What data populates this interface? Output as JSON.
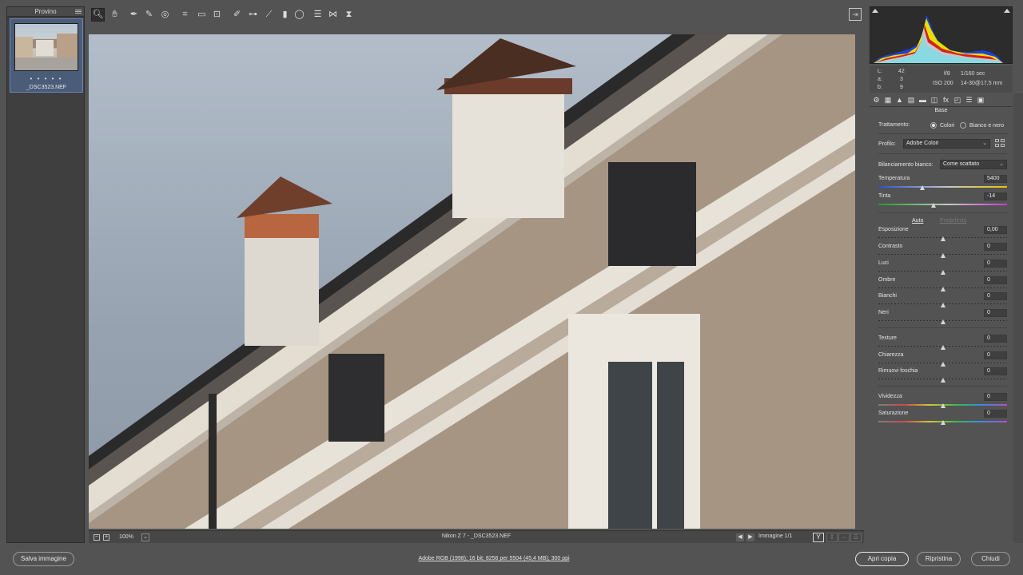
{
  "filmstrip": {
    "title": "Provino",
    "thumb": {
      "stars": "• • • • •",
      "filename": "_DSC3523.NEF"
    }
  },
  "toolbar": {
    "tools": [
      {
        "name": "zoom-tool",
        "glyph": "🔍︎",
        "active": true
      },
      {
        "name": "hand-tool",
        "glyph": "✋︎"
      },
      {
        "name": "white-balance-tool",
        "glyph": "✒"
      },
      {
        "name": "color-sampler-tool",
        "glyph": "✎"
      },
      {
        "name": "targeted-adjustment-tool",
        "glyph": "◎"
      },
      {
        "name": "crop-tool",
        "glyph": "⌗"
      },
      {
        "name": "straighten-tool",
        "glyph": "▭"
      },
      {
        "name": "transform-tool",
        "glyph": "⊡"
      },
      {
        "name": "spot-removal-tool",
        "glyph": "✐"
      },
      {
        "name": "red-eye-tool",
        "glyph": "⊶"
      },
      {
        "name": "adjustment-brush-tool",
        "glyph": "⟋"
      },
      {
        "name": "graduated-filter-tool",
        "glyph": "▮"
      },
      {
        "name": "radial-filter-tool",
        "glyph": "◯"
      },
      {
        "name": "preferences-tool",
        "glyph": "☰"
      },
      {
        "name": "rotate-left-tool",
        "glyph": "⋈"
      },
      {
        "name": "rotate-right-tool",
        "glyph": "⧗"
      }
    ],
    "export_glyph": "⇥"
  },
  "canvas_status": {
    "zoom_out": "−",
    "zoom_in": "+",
    "zoom": "100%",
    "zoom_caret": "⌄",
    "file_info": "Nikon Z 7  -  _DSC3523.NEF",
    "prev": "◀",
    "next": "▶",
    "image_count": "Immagine 1/1",
    "view_y": "Y",
    "view_compare": "⇕",
    "view_swap": "⇔",
    "view_settings": "☰"
  },
  "readout": {
    "L_label": "L:",
    "L": "42",
    "a_label": "a:",
    "a": "3",
    "b_label": "b:",
    "b": "9",
    "aperture": "f/8",
    "shutter": "1/160 sec",
    "iso": "ISO 200",
    "lens": "14-30@17,5 mm"
  },
  "panel": {
    "title": "Base",
    "tabs": [
      "⚙",
      "▦",
      "▲",
      "▤",
      "▬",
      "◫",
      "fx",
      "◰",
      "☰",
      "▣"
    ],
    "treatment_label": "Trattamento:",
    "treatment_color": "Colori",
    "treatment_bw": "Bianco e nero",
    "profile_label": "Profilo:",
    "profile_value": "Adobe Colori",
    "wb_label": "Bilanciamento bianco:",
    "wb_value": "Come scattato",
    "auto": "Auto",
    "default": "Predefinito",
    "caret": "⌄",
    "sliders": [
      {
        "key": "temperatura",
        "label": "Temperatura",
        "value": "5400",
        "pos": 0.34
      },
      {
        "key": "tinta",
        "label": "Tinta",
        "value": "-14",
        "pos": 0.43
      },
      {
        "key": "esposizione",
        "label": "Esposizione",
        "value": "0,00",
        "pos": 0.5
      },
      {
        "key": "contrasto",
        "label": "Contrasto",
        "value": "0",
        "pos": 0.5
      },
      {
        "key": "luci",
        "label": "Luci",
        "value": "0",
        "pos": 0.5
      },
      {
        "key": "ombre",
        "label": "Ombre",
        "value": "0",
        "pos": 0.5
      },
      {
        "key": "bianchi",
        "label": "Bianchi",
        "value": "0",
        "pos": 0.5
      },
      {
        "key": "neri",
        "label": "Neri",
        "value": "0",
        "pos": 0.5
      },
      {
        "key": "texture",
        "label": "Texture",
        "value": "0",
        "pos": 0.5
      },
      {
        "key": "chiarezza",
        "label": "Chiarezza",
        "value": "0",
        "pos": 0.5
      },
      {
        "key": "rimuovi-foschia",
        "label": "Rimuovi foschia",
        "value": "0",
        "pos": 0.5
      },
      {
        "key": "vividezza",
        "label": "Vividezza",
        "value": "0",
        "pos": 0.5
      },
      {
        "key": "saturazione",
        "label": "Saturazione",
        "value": "0",
        "pos": 0.5
      }
    ]
  },
  "bottom": {
    "save": "Salva immagine",
    "workflow": "Adobe RGB (1998); 16 bit; 8256 per 5504 (45,4 MB); 300 ppi",
    "open_copy": "Apri copia",
    "reset": "Ripristina",
    "close": "Chiudi"
  },
  "colors": {
    "accent": "#6a86b6",
    "facade": "#a79584",
    "sky": "#9aa6b4",
    "trim": "#e7e2d8"
  }
}
